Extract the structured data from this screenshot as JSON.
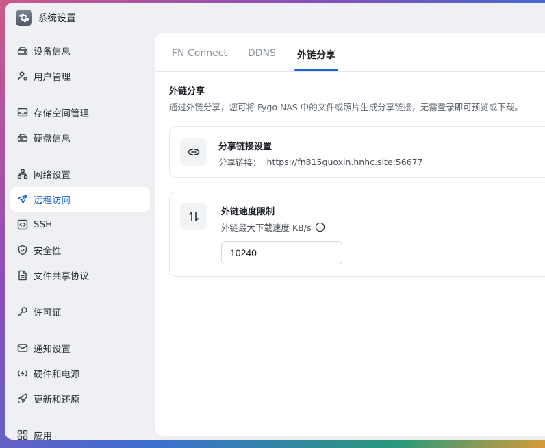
{
  "app": {
    "title": "系统设置"
  },
  "sidebar": {
    "items": [
      {
        "label": "设备信息",
        "icon": "hard-drive-icon"
      },
      {
        "label": "用户管理",
        "icon": "user-icon"
      },
      {
        "label": "存储空间管理",
        "icon": "storage-icon"
      },
      {
        "label": "硬盘信息",
        "icon": "disk-icon"
      },
      {
        "label": "网络设置",
        "icon": "network-icon"
      },
      {
        "label": "远程访问",
        "icon": "send-icon",
        "active": true
      },
      {
        "label": "SSH",
        "icon": "code-icon"
      },
      {
        "label": "安全性",
        "icon": "shield-icon"
      },
      {
        "label": "文件共享协议",
        "icon": "file-icon"
      },
      {
        "label": "许可证",
        "icon": "key-icon"
      },
      {
        "label": "通知设置",
        "icon": "mail-icon"
      },
      {
        "label": "硬件和电源",
        "icon": "power-icon"
      },
      {
        "label": "更新和还原",
        "icon": "rocket-icon"
      },
      {
        "label": "应用",
        "icon": "grid-icon"
      }
    ]
  },
  "tabs": [
    {
      "label": "FN Connect"
    },
    {
      "label": "DDNS"
    },
    {
      "label": "外链分享",
      "active": true
    }
  ],
  "section": {
    "title": "外链分享",
    "description": "通过外链分享，您可将 Fygo NAS 中的文件或照片生成分享链接，无需登录即可预览或下载。"
  },
  "share_card": {
    "title": "分享链接设置",
    "link_label": "分享链接：",
    "link_value": "https://fn815guoxin.hnhc.site:56677",
    "icon": "link-icon"
  },
  "speed_card": {
    "title": "外链速度限制",
    "subtitle": "外链最大下载速度 KB/s",
    "value": "10240",
    "icon": "arrows-updown-icon",
    "info_icon": "info-icon"
  },
  "colors": {
    "accent": "#1a66d9"
  }
}
